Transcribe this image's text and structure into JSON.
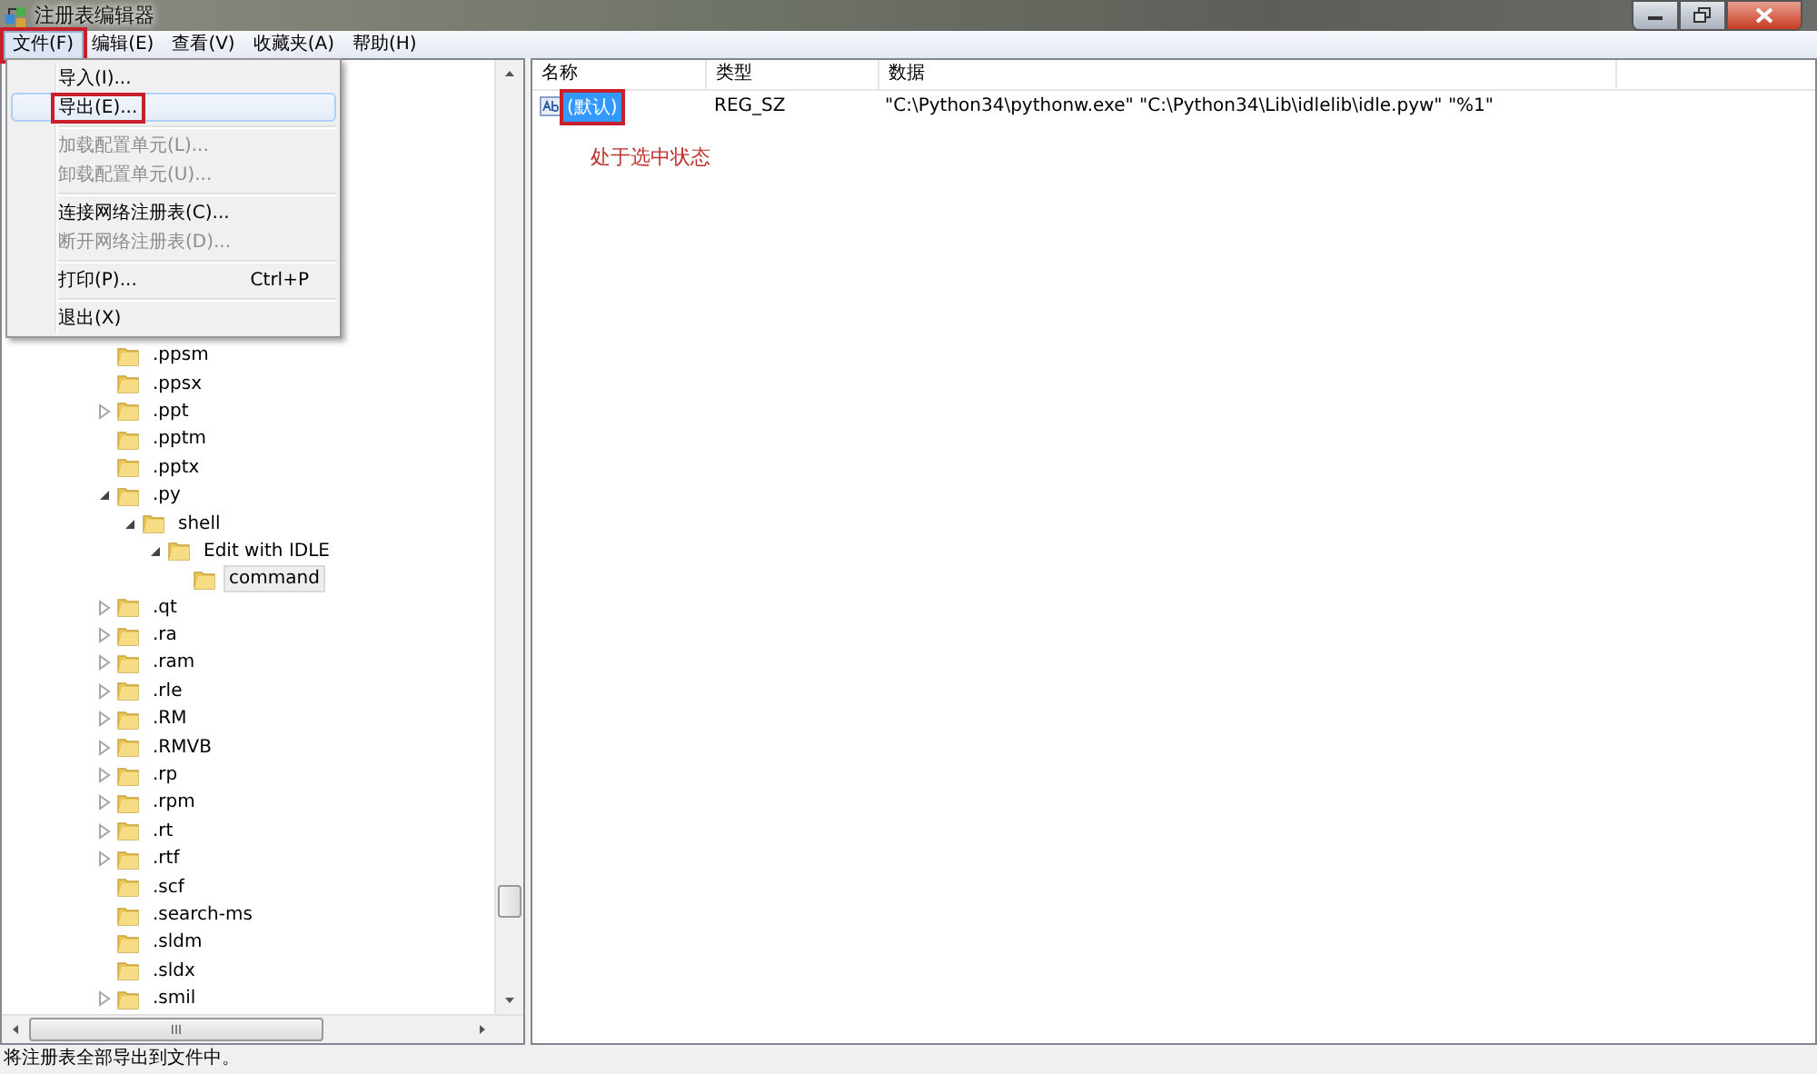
{
  "window": {
    "title": "注册表编辑器"
  },
  "menubar": [
    {
      "label": "文件(F)",
      "selected": true,
      "annotated": true
    },
    {
      "label": "编辑(E)",
      "selected": false,
      "annotated": false
    },
    {
      "label": "查看(V)",
      "selected": false,
      "annotated": false
    },
    {
      "label": "收藏夹(A)",
      "selected": false,
      "annotated": false
    },
    {
      "label": "帮助(H)",
      "selected": false,
      "annotated": false
    }
  ],
  "file_menu": [
    {
      "kind": "item",
      "label": "导入(I)...",
      "disabled": false,
      "selected": false,
      "annotated": false
    },
    {
      "kind": "item",
      "label": "导出(E)...",
      "disabled": false,
      "selected": true,
      "annotated": true
    },
    {
      "kind": "separator"
    },
    {
      "kind": "item",
      "label": "加载配置单元(L)...",
      "disabled": true,
      "selected": false,
      "annotated": false
    },
    {
      "kind": "item",
      "label": "卸载配置单元(U)...",
      "disabled": true,
      "selected": false,
      "annotated": false
    },
    {
      "kind": "separator"
    },
    {
      "kind": "item",
      "label": "连接网络注册表(C)...",
      "disabled": false,
      "selected": false,
      "annotated": false
    },
    {
      "kind": "item",
      "label": "断开网络注册表(D)...",
      "disabled": true,
      "selected": false,
      "annotated": false
    },
    {
      "kind": "separator"
    },
    {
      "kind": "item",
      "label": "打印(P)...",
      "shortcut": "Ctrl+P",
      "disabled": false,
      "selected": false,
      "annotated": false
    },
    {
      "kind": "separator"
    },
    {
      "kind": "item",
      "label": "退出(X)",
      "disabled": false,
      "selected": false,
      "annotated": false
    }
  ],
  "tree": [
    {
      "label": ".ppsm",
      "kind": "leaf",
      "selected": false
    },
    {
      "label": ".ppsx",
      "kind": "leaf",
      "selected": false
    },
    {
      "label": ".ppt",
      "kind": "collapsed",
      "selected": false
    },
    {
      "label": ".pptm",
      "kind": "leaf",
      "selected": false
    },
    {
      "label": ".pptx",
      "kind": "leaf",
      "selected": false
    },
    {
      "label": ".py",
      "kind": "expanded",
      "selected": false,
      "children": [
        {
          "label": "shell",
          "kind": "expanded",
          "selected": false,
          "children": [
            {
              "label": "Edit with IDLE",
              "kind": "expanded",
              "selected": false,
              "children": [
                {
                  "label": "command",
                  "kind": "leaf",
                  "selected": true
                }
              ]
            }
          ]
        }
      ]
    },
    {
      "label": ".qt",
      "kind": "collapsed",
      "selected": false
    },
    {
      "label": ".ra",
      "kind": "collapsed",
      "selected": false
    },
    {
      "label": ".ram",
      "kind": "collapsed",
      "selected": false
    },
    {
      "label": ".rle",
      "kind": "collapsed",
      "selected": false
    },
    {
      "label": ".RM",
      "kind": "collapsed",
      "selected": false
    },
    {
      "label": ".RMVB",
      "kind": "collapsed",
      "selected": false
    },
    {
      "label": ".rp",
      "kind": "collapsed",
      "selected": false
    },
    {
      "label": ".rpm",
      "kind": "collapsed",
      "selected": false
    },
    {
      "label": ".rt",
      "kind": "collapsed",
      "selected": false
    },
    {
      "label": ".rtf",
      "kind": "collapsed",
      "selected": false
    },
    {
      "label": ".scf",
      "kind": "leaf",
      "selected": false
    },
    {
      "label": ".search-ms",
      "kind": "leaf",
      "selected": false
    },
    {
      "label": ".sldm",
      "kind": "leaf",
      "selected": false
    },
    {
      "label": ".sldx",
      "kind": "leaf",
      "selected": false
    },
    {
      "label": ".smil",
      "kind": "collapsed",
      "selected": false
    }
  ],
  "hscroll_grip": "III",
  "values": {
    "columns": [
      "名称",
      "类型",
      "数据"
    ],
    "rows": [
      {
        "name": "(默认)",
        "type": "REG_SZ",
        "data": "\"C:\\Python34\\pythonw.exe\" \"C:\\Python34\\Lib\\idlelib\\idle.pyw\" \"%1\"",
        "selected": true,
        "annotated": true
      }
    ]
  },
  "annotation": "处于选中状态",
  "status_bar": "将注册表全部导出到文件中。"
}
